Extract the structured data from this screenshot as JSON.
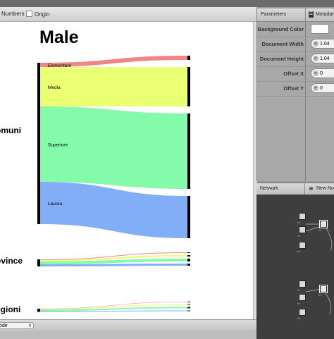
{
  "toolbar": {
    "numbers_label": "Numbers",
    "origin_label": "Origin"
  },
  "canvas": {
    "title": "Male",
    "groups": [
      {
        "label": "omuni",
        "categories": [
          "Elementare",
          "Media",
          "Superiore",
          "Laurea"
        ]
      },
      {
        "label": "ovince"
      },
      {
        "label": "egioni"
      }
    ]
  },
  "chart_data": {
    "type": "sankey",
    "title": "Male",
    "nodes": [
      "omuni",
      "ovince",
      "egioni"
    ],
    "categories": [
      "Elementare",
      "Media",
      "Superiore",
      "Laurea"
    ],
    "colors": {
      "Elementare": "#f08080",
      "Media": "#eaff6a",
      "Superiore": "#7dfaa6",
      "Laurea": "#7aaaf5"
    },
    "series": [
      {
        "name": "Elementare",
        "values": [
          6,
          1,
          0.5
        ]
      },
      {
        "name": "Media",
        "values": [
          56,
          2,
          1
        ]
      },
      {
        "name": "Superiore",
        "values": [
          107,
          4,
          2
        ]
      },
      {
        "name": "Laurea",
        "values": [
          60,
          3,
          1
        ]
      }
    ]
  },
  "bottombar": {
    "mode_value": "ode"
  },
  "params": {
    "tab_parameters": "Parameters",
    "tab_metadata": "Metadat",
    "rows": [
      {
        "label": "Background Color",
        "value": ""
      },
      {
        "label": "Document Width",
        "value": "1.04"
      },
      {
        "label": "Document Height",
        "value": "1.04"
      },
      {
        "label": "Offset X",
        "value": "0"
      },
      {
        "label": "Offset Y",
        "value": "0"
      }
    ]
  },
  "network": {
    "title": "Network",
    "new_node_label": "New No"
  }
}
